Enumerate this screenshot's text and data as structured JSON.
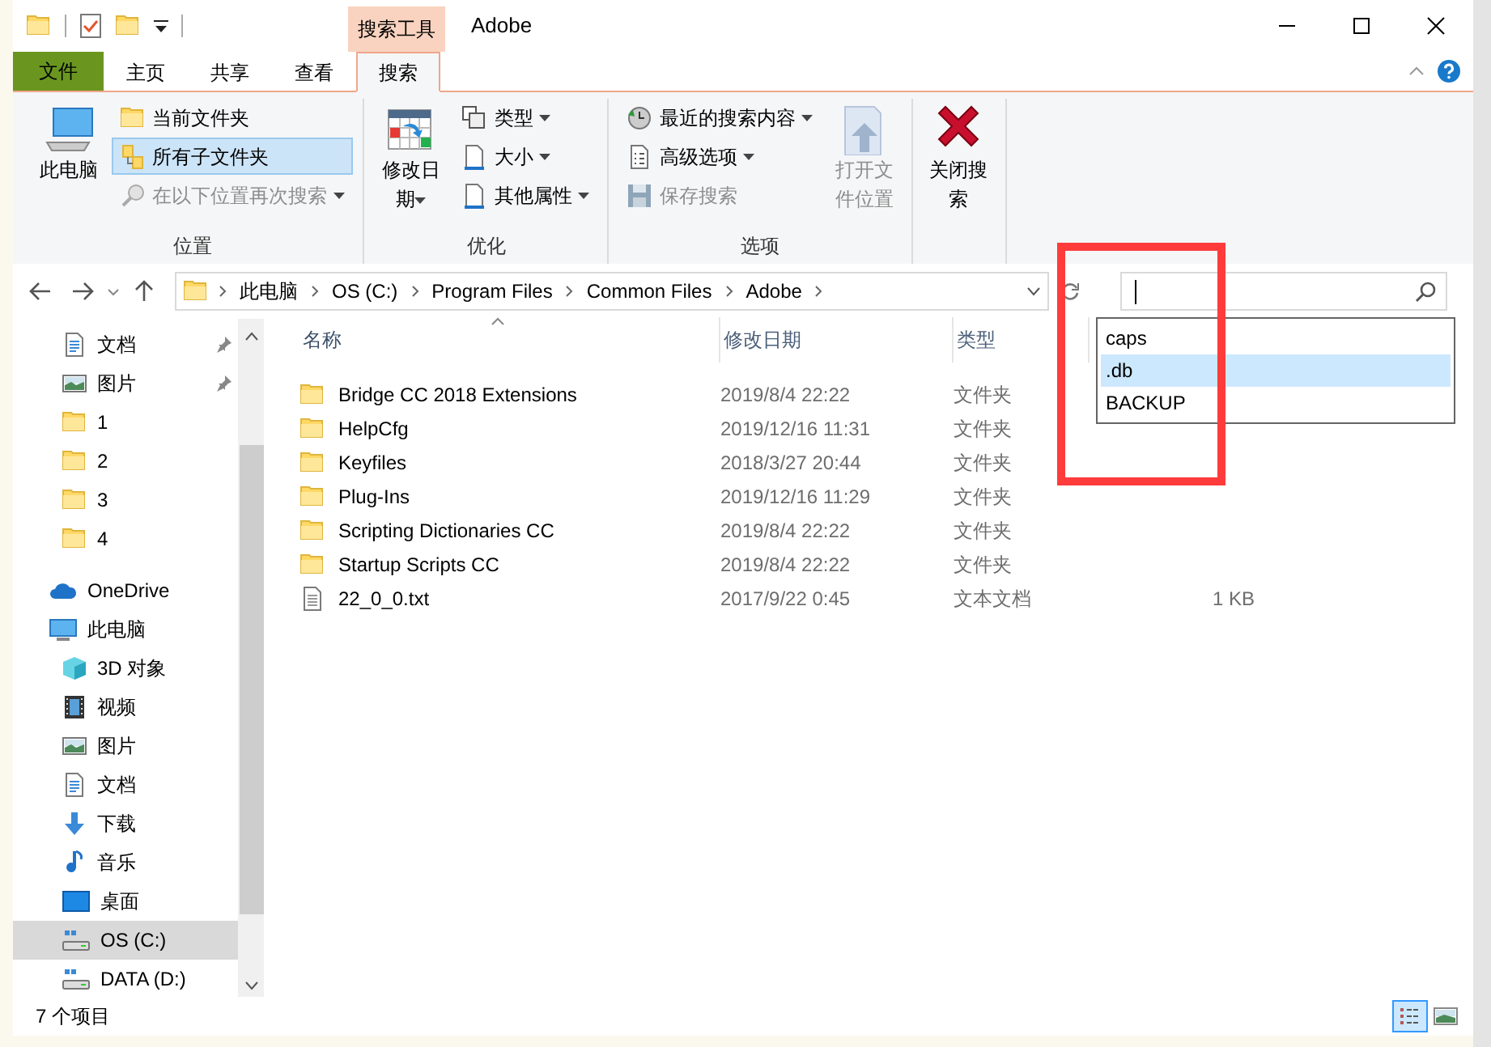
{
  "title_bar": {
    "context_tab": "搜索工具",
    "title": "Adobe"
  },
  "ribbon_tabs": [
    {
      "label": "文件",
      "kind": "file",
      "selected": false
    },
    {
      "label": "主页",
      "kind": "tab",
      "selected": false
    },
    {
      "label": "共享",
      "kind": "tab",
      "selected": false
    },
    {
      "label": "查看",
      "kind": "tab",
      "selected": false
    },
    {
      "label": "搜索",
      "kind": "tab",
      "selected": true
    }
  ],
  "ribbon_groups": [
    {
      "label": "位置",
      "items": [
        {
          "label": "此电脑",
          "kind": "large",
          "dropdown": false,
          "disabled": false,
          "selected": false
        },
        {
          "label": "当前文件夹",
          "kind": "small",
          "dropdown": false,
          "disabled": false,
          "selected": false
        },
        {
          "label": "所有子文件夹",
          "kind": "small",
          "dropdown": false,
          "disabled": false,
          "selected": true
        },
        {
          "label": "在以下位置再次搜索",
          "kind": "small",
          "dropdown": true,
          "disabled": true,
          "selected": false
        }
      ]
    },
    {
      "label": "优化",
      "items": [
        {
          "label": "修改日期",
          "kind": "large",
          "dropdown": true,
          "disabled": false,
          "selected": false
        },
        {
          "label": "类型",
          "kind": "small",
          "dropdown": true,
          "disabled": false,
          "selected": false
        },
        {
          "label": "大小",
          "kind": "small",
          "dropdown": true,
          "disabled": false,
          "selected": false
        },
        {
          "label": "其他属性",
          "kind": "small",
          "dropdown": true,
          "disabled": false,
          "selected": false
        }
      ]
    },
    {
      "label": "选项",
      "items": [
        {
          "label": "最近的搜索内容",
          "kind": "small",
          "dropdown": true,
          "disabled": false,
          "selected": false
        },
        {
          "label": "高级选项",
          "kind": "small",
          "dropdown": true,
          "disabled": false,
          "selected": false
        },
        {
          "label": "保存搜索",
          "kind": "small",
          "dropdown": false,
          "disabled": true,
          "selected": false
        },
        {
          "label": "打开文件位置",
          "kind": "large",
          "dropdown": false,
          "disabled": true,
          "selected": false
        }
      ]
    },
    {
      "items": [
        {
          "label": "关闭搜索",
          "kind": "large",
          "dropdown": false,
          "disabled": false,
          "selected": false
        }
      ]
    }
  ],
  "address_bar": {
    "path": [
      "此电脑",
      "OS (C:)",
      "Program Files",
      "Common Files",
      "Adobe"
    ]
  },
  "search": {
    "suggestions": [
      {
        "text": "caps",
        "selected": false
      },
      {
        "text": ".db",
        "selected": true
      },
      {
        "text": "BACKUP",
        "selected": false
      }
    ]
  },
  "nav_pane": {
    "quick_access_children": [
      {
        "label": "文档",
        "kind": "document",
        "pinned": true,
        "selected": false
      },
      {
        "label": "图片",
        "kind": "pictures",
        "pinned": true,
        "selected": false
      },
      {
        "label": "1",
        "kind": "folder",
        "pinned": false,
        "selected": false
      },
      {
        "label": "2",
        "kind": "folder",
        "pinned": false,
        "selected": false
      },
      {
        "label": "3",
        "kind": "folder",
        "pinned": false,
        "selected": false
      },
      {
        "label": "4",
        "kind": "folder",
        "pinned": false,
        "selected": false
      }
    ],
    "tree": [
      {
        "label": "OneDrive",
        "kind": "cloud",
        "pinned": false,
        "selected": false
      },
      {
        "label": "此电脑",
        "kind": "computer",
        "pinned": false,
        "selected": false,
        "children": [
          {
            "label": "3D 对象",
            "kind": "objects3d",
            "pinned": false,
            "selected": false
          },
          {
            "label": "视频",
            "kind": "videos",
            "pinned": false,
            "selected": false
          },
          {
            "label": "图片",
            "kind": "pictures",
            "pinned": false,
            "selected": false
          },
          {
            "label": "文档",
            "kind": "document",
            "pinned": false,
            "selected": false
          },
          {
            "label": "下载",
            "kind": "downloads",
            "pinned": false,
            "selected": false
          },
          {
            "label": "音乐",
            "kind": "music",
            "pinned": false,
            "selected": false
          },
          {
            "label": "桌面",
            "kind": "desktop",
            "pinned": false,
            "selected": false
          },
          {
            "label": "OS (C:)",
            "kind": "drive",
            "pinned": false,
            "selected": true
          },
          {
            "label": "DATA (D:)",
            "kind": "drive",
            "pinned": false,
            "selected": false
          }
        ]
      }
    ]
  },
  "file_list": {
    "columns": [
      {
        "label": "名称",
        "sorted": true
      },
      {
        "label": "修改日期",
        "sorted": false
      },
      {
        "label": "类型",
        "sorted": false
      }
    ],
    "rows": [
      {
        "kind": "folder",
        "name": "Bridge CC 2018 Extensions",
        "modified": "2019/8/4 22:22",
        "type": "文件夹"
      },
      {
        "kind": "folder",
        "name": "HelpCfg",
        "modified": "2019/12/16 11:31",
        "type": "文件夹"
      },
      {
        "kind": "folder",
        "name": "Keyfiles",
        "modified": "2018/3/27 20:44",
        "type": "文件夹"
      },
      {
        "kind": "folder",
        "name": "Plug-Ins",
        "modified": "2019/12/16 11:29",
        "type": "文件夹"
      },
      {
        "kind": "folder",
        "name": "Scripting Dictionaries CC",
        "modified": "2019/8/4 22:22",
        "type": "文件夹"
      },
      {
        "kind": "folder",
        "name": "Startup Scripts CC",
        "modified": "2019/8/4 22:22",
        "type": "文件夹"
      },
      {
        "kind": "file",
        "name": "22_0_0.txt",
        "modified": "2017/9/22 0:45",
        "type": "文本文档",
        "size": "1 KB"
      }
    ]
  },
  "status_bar": {
    "item_count": "7 个项目",
    "views": [
      {
        "kind": "details",
        "selected": true
      },
      {
        "kind": "large_icons",
        "selected": false
      }
    ]
  },
  "annotation": {
    "kind": "rectangle"
  }
}
